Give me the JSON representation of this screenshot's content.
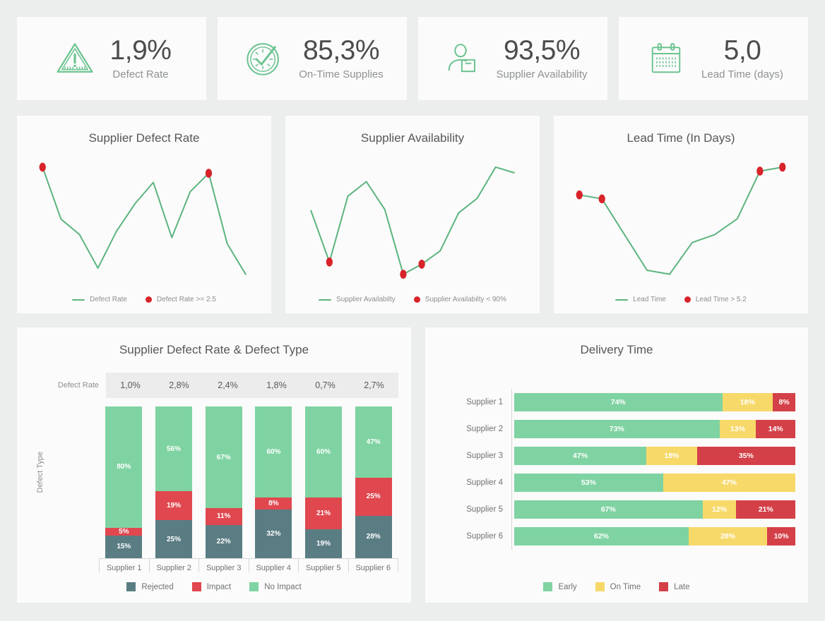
{
  "colors": {
    "green": "#6cc390",
    "green_bar": "#7fd3a2",
    "line_green": "#5cb47f",
    "red": "#d8232a",
    "red_bar": "#e0474f",
    "red_late": "#d44048",
    "teal_dark": "#5a7d83",
    "yellow": "#f7d96a",
    "page_bg": "#eceded",
    "card_bg": "#fbfbfb",
    "text_dark": "#4c4c4c",
    "text_muted": "#8e9192"
  },
  "kpis": [
    {
      "icon": "warning-triangle-icon",
      "value": "1,9%",
      "label": "Defect Rate"
    },
    {
      "icon": "clock-check-icon",
      "value": "85,3%",
      "label": "On-Time Supplies"
    },
    {
      "icon": "supplier-person-box-icon",
      "value": "93,5%",
      "label": "Supplier Availability"
    },
    {
      "icon": "calendar-icon",
      "value": "5,0",
      "label": "Lead Time (days)"
    }
  ],
  "sparklines": [
    {
      "title": "Supplier Defect Rate",
      "legend_line": "Defect Rate",
      "legend_dot": "Defect Rate >= 2.5",
      "chart_data": {
        "type": "line",
        "title": "Supplier Defect Rate",
        "xlabel": "",
        "ylabel": "Defect Rate",
        "x": [
          1,
          2,
          3,
          4,
          5,
          6,
          7,
          8,
          9,
          10,
          11,
          12
        ],
        "values": [
          2.6,
          1.75,
          1.5,
          0.95,
          1.55,
          2.0,
          2.35,
          1.45,
          2.2,
          2.5,
          1.35,
          0.85
        ],
        "threshold": 2.5,
        "threshold_label": "Defect Rate >= 2.5",
        "highlighted_points": [
          {
            "x": 1,
            "y": 2.6
          },
          {
            "x": 10,
            "y": 2.5
          }
        ],
        "grid": false,
        "legend_position": "bottom"
      }
    },
    {
      "title": "Supplier Availability",
      "legend_line": "Supplier Availabilty",
      "legend_dot": "Supplier Availabilty < 90%",
      "chart_data": {
        "type": "line",
        "title": "Supplier Availability",
        "xlabel": "",
        "ylabel": "Supplier Availability (%)",
        "x": [
          1,
          2,
          3,
          4,
          5,
          6,
          7,
          8,
          9,
          10,
          11,
          12
        ],
        "values": [
          93.2,
          88.6,
          94.5,
          95.8,
          93.3,
          87.5,
          88.4,
          89.6,
          93.0,
          94.3,
          97.1,
          96.6
        ],
        "threshold": 90,
        "threshold_label": "Supplier Availabilty < 90%",
        "highlighted_points": [
          {
            "x": 2,
            "y": 88.6
          },
          {
            "x": 6,
            "y": 87.5
          },
          {
            "x": 7,
            "y": 88.4
          }
        ],
        "grid": false,
        "legend_position": "bottom"
      }
    },
    {
      "title": "Lead Time (In Days)",
      "legend_line": "Lead Time",
      "legend_dot": "Lead Time > 5.2",
      "chart_data": {
        "type": "line",
        "title": "Lead Time (In Days)",
        "xlabel": "",
        "ylabel": "Lead Time (days)",
        "x": [
          1,
          2,
          3,
          4,
          5,
          6,
          7,
          8,
          9,
          10
        ],
        "values": [
          5.3,
          5.25,
          4.8,
          4.35,
          4.3,
          4.7,
          4.8,
          5.0,
          5.6,
          5.65
        ],
        "threshold": 5.2,
        "threshold_label": "Lead Time > 5.2",
        "highlighted_points": [
          {
            "x": 1,
            "y": 5.3
          },
          {
            "x": 2,
            "y": 5.25
          },
          {
            "x": 9,
            "y": 5.6
          },
          {
            "x": 10,
            "y": 5.65
          }
        ],
        "grid": false,
        "legend_position": "bottom"
      }
    }
  ],
  "defect_chart": {
    "title": "Supplier Defect Rate & Defect Type",
    "defect_rate_label": "Defect Rate",
    "y_axis_label": "Defect Type",
    "legend": [
      {
        "name": "Rejected",
        "color": "#5a7d83"
      },
      {
        "name": "Impact",
        "color": "#e0474f"
      },
      {
        "name": "No Impact",
        "color": "#7fd3a2"
      }
    ],
    "chart_data": {
      "type": "bar",
      "title": "Supplier Defect Rate & Defect Type",
      "xlabel": "",
      "ylabel": "Defect Type",
      "categories": [
        "Supplier 1",
        "Supplier 2",
        "Supplier 3",
        "Supplier 4",
        "Supplier 5",
        "Supplier 6"
      ],
      "defect_rate": [
        "1,0%",
        "2,8%",
        "2,4%",
        "1,8%",
        "0,7%",
        "2,7%"
      ],
      "stacked": true,
      "ylim": [
        0,
        100
      ],
      "series": [
        {
          "name": "Rejected",
          "values": [
            15,
            25,
            22,
            32,
            19,
            28
          ],
          "labels": [
            "15%",
            "25%",
            "22%",
            "32%",
            "19%",
            "28%"
          ]
        },
        {
          "name": "Impact",
          "values": [
            5,
            19,
            11,
            8,
            21,
            25
          ],
          "labels": [
            "5%",
            "19%",
            "11%",
            "8%",
            "21%",
            "25%"
          ]
        },
        {
          "name": "No Impact",
          "values": [
            80,
            56,
            67,
            60,
            60,
            47
          ],
          "labels": [
            "80%",
            "56%",
            "67%",
            "60%",
            "60%",
            "47%"
          ]
        }
      ],
      "grid": false,
      "legend_position": "bottom"
    }
  },
  "delivery_chart": {
    "title": "Delivery Time",
    "legend": [
      {
        "name": "Early",
        "color": "#7fd3a2"
      },
      {
        "name": "On Time",
        "color": "#f7d96a"
      },
      {
        "name": "Late",
        "color": "#d44048"
      }
    ],
    "chart_data": {
      "type": "bar",
      "title": "Delivery Time",
      "orientation": "horizontal",
      "stacked": true,
      "xlabel": "",
      "ylabel": "",
      "xlim": [
        0,
        100
      ],
      "categories": [
        "Supplier 1",
        "Supplier 2",
        "Supplier 3",
        "Supplier 4",
        "Supplier 5",
        "Supplier 6"
      ],
      "series": [
        {
          "name": "Early",
          "values": [
            74,
            73,
            47,
            53,
            67,
            62
          ],
          "labels": [
            "74%",
            "73%",
            "47%",
            "53%",
            "67%",
            "62%"
          ]
        },
        {
          "name": "On Time",
          "values": [
            18,
            13,
            18,
            47,
            12,
            28
          ],
          "labels": [
            "18%",
            "13%",
            "18%",
            "47%",
            "12%",
            "28%"
          ]
        },
        {
          "name": "Late",
          "values": [
            8,
            14,
            35,
            0,
            21,
            10
          ],
          "labels": [
            "8%",
            "14%",
            "35%",
            "",
            "21%",
            "10%"
          ]
        }
      ],
      "grid": false,
      "legend_position": "bottom"
    }
  }
}
